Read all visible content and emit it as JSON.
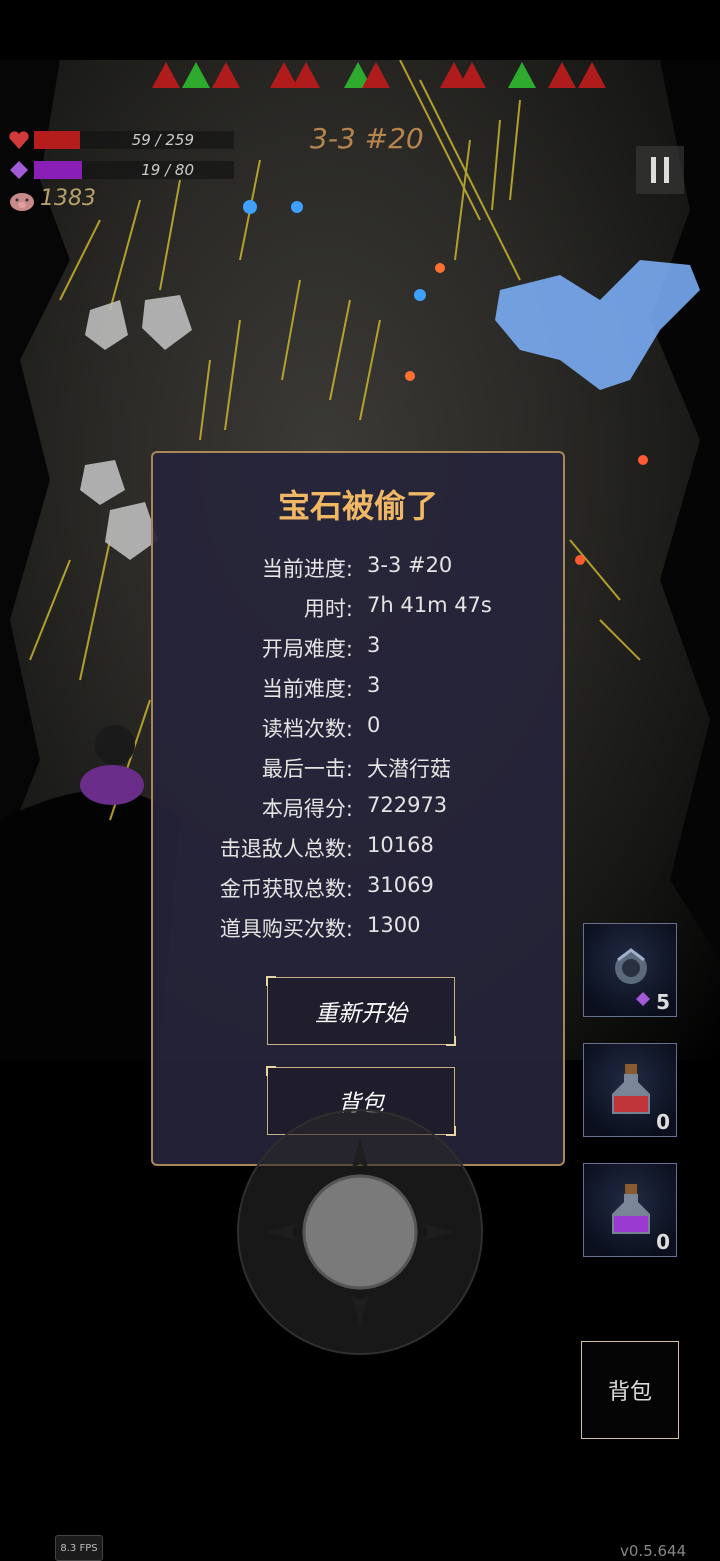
{
  "hud": {
    "hp_text": "59 / 259",
    "hp_fraction": 0.228,
    "mp_text": "19 / 80",
    "mp_fraction": 0.2375,
    "gold": "1383",
    "stage": "3-3 #20",
    "icons": [
      "heart-icon",
      "gem-icon",
      "pig-icon",
      "pause-icon"
    ]
  },
  "dialog": {
    "title": "宝石被偷了",
    "rows": [
      {
        "k": "当前进度:",
        "v": "3-3 #20"
      },
      {
        "k": "用时:",
        "v": "7h 41m 47s"
      },
      {
        "k": "开局难度:",
        "v": "3"
      },
      {
        "k": "当前难度:",
        "v": "3"
      },
      {
        "k": "读档次数:",
        "v": "0"
      },
      {
        "k": "最后一击:",
        "v": "大潜行菇"
      },
      {
        "k": "本局得分:",
        "v": "722973"
      },
      {
        "k": "击退敌人总数:",
        "v": "10168"
      },
      {
        "k": "金币获取总数:",
        "v": "31069"
      },
      {
        "k": "道具购买次数:",
        "v": "1300"
      }
    ],
    "restart_label": "重新开始",
    "bag_label": "背包"
  },
  "slots": [
    {
      "name": "orb-item",
      "count": "5",
      "icon": "gem-icon"
    },
    {
      "name": "red-potion",
      "count": "0"
    },
    {
      "name": "purple-potion",
      "count": "0"
    }
  ],
  "bag_button_label": "背包",
  "fps": "8.3 FPS",
  "version": "v0.5.644",
  "colors": {
    "hp": "#b51c1c",
    "mp": "#8a1fb5",
    "dialog_title": "#f0b765",
    "dialog_border": "#a88858"
  }
}
